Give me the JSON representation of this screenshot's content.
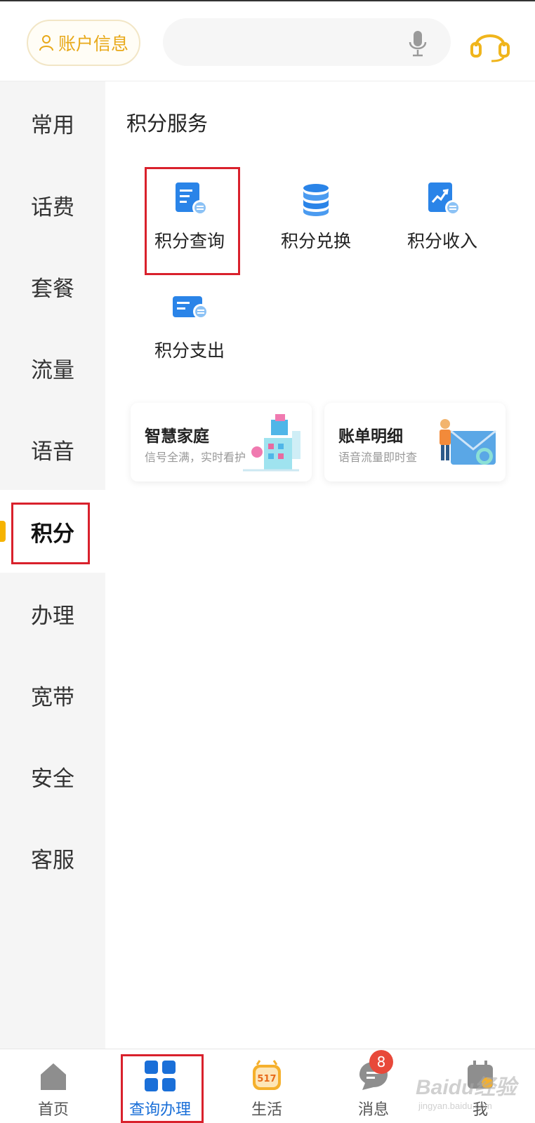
{
  "header": {
    "account_label": "账户信息",
    "icons": {
      "account": "person-icon",
      "mic": "microphone-icon",
      "service": "headset-icon"
    }
  },
  "sidebar": {
    "items": [
      {
        "label": "常用"
      },
      {
        "label": "话费"
      },
      {
        "label": "套餐"
      },
      {
        "label": "流量"
      },
      {
        "label": "语音"
      },
      {
        "label": "积分",
        "active": true
      },
      {
        "label": "办理"
      },
      {
        "label": "宽带"
      },
      {
        "label": "安全"
      },
      {
        "label": "客服"
      }
    ]
  },
  "main": {
    "section_title": "积分服务",
    "services": [
      {
        "label": "积分查询",
        "icon": "points-query-icon"
      },
      {
        "label": "积分兑换",
        "icon": "points-exchange-icon"
      },
      {
        "label": "积分收入",
        "icon": "points-income-icon"
      },
      {
        "label": "积分支出",
        "icon": "points-expense-icon"
      }
    ],
    "cards": [
      {
        "title": "智慧家庭",
        "subtitle": "信号全满，实时看护"
      },
      {
        "title": "账单明细",
        "subtitle": "语音流量即时查"
      }
    ]
  },
  "bottom_nav": {
    "items": [
      {
        "label": "首页",
        "icon": "home-icon"
      },
      {
        "label": "查询办理",
        "icon": "grid-icon",
        "active": true
      },
      {
        "label": "生活",
        "icon": "life-517-icon",
        "icon_text": "517"
      },
      {
        "label": "消息",
        "icon": "message-icon"
      },
      {
        "label": "我",
        "icon": "me-icon"
      }
    ],
    "message_badge": "8"
  },
  "watermark": {
    "line1": "Baidu经验",
    "line2": "jingyan.baidu.com"
  },
  "colors": {
    "accent": "#e8a919",
    "active_nav": "#1a6fd8",
    "highlight_box": "#d9212c",
    "icon_blue": "#2a84e8"
  }
}
